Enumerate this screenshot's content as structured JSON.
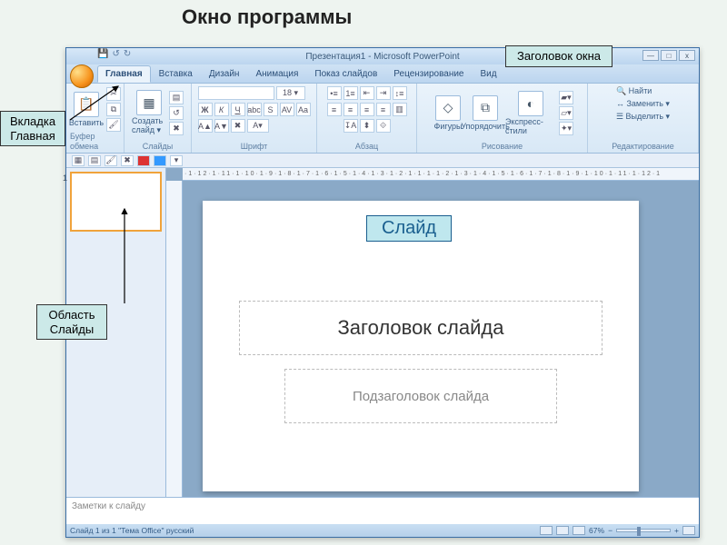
{
  "page": {
    "title": "Окно программы"
  },
  "callouts": {
    "title_bar": "Заголовок окна",
    "tab_home": "Вкладка Главная",
    "slides_area": "Область Слайды",
    "slide": "Слайд"
  },
  "titlebar": {
    "text": "Презентация1 - Microsoft PowerPoint",
    "min": "—",
    "max": "□",
    "close": "x"
  },
  "tabs": {
    "items": [
      {
        "label": "Главная",
        "active": true
      },
      {
        "label": "Вставка"
      },
      {
        "label": "Дизайн"
      },
      {
        "label": "Анимация"
      },
      {
        "label": "Показ слайдов"
      },
      {
        "label": "Рецензирование"
      },
      {
        "label": "Вид"
      }
    ]
  },
  "ribbon": {
    "clipboard": {
      "paste": "Вставить",
      "group": "Буфер обмена"
    },
    "slides": {
      "new": "Создать слайд ▾",
      "group": "Слайды"
    },
    "font": {
      "group": "Шрифт",
      "sample": "A",
      "sizes": "18 ▾"
    },
    "paragraph": {
      "group": "Абзац"
    },
    "drawing": {
      "shapes": "Фигуры",
      "arrange": "Упорядочить",
      "quickstyles": "Экспресс-стили",
      "group": "Рисование"
    },
    "editing": {
      "find": "Найти",
      "replace": "Заменить ▾",
      "select": "Выделить ▾",
      "group": "Редактирование"
    }
  },
  "ruler": {
    "ticks": "·1·12·1·11·1·10·1·9·1·8·1·7·1·6·1·5·1·4·1·3·1·2·1·1·1·1·2·1·3·1·4·1·5·1·6·1·7·1·8·1·9·1·10·1·11·1·12·1"
  },
  "slide": {
    "title_placeholder": "Заголовок слайда",
    "subtitle_placeholder": "Подзаголовок слайда"
  },
  "notes": {
    "placeholder": "Заметки к слайду"
  },
  "status": {
    "left": "Слайд 1 из 1   \"Тема Office\"   русский",
    "zoom": "67%"
  }
}
